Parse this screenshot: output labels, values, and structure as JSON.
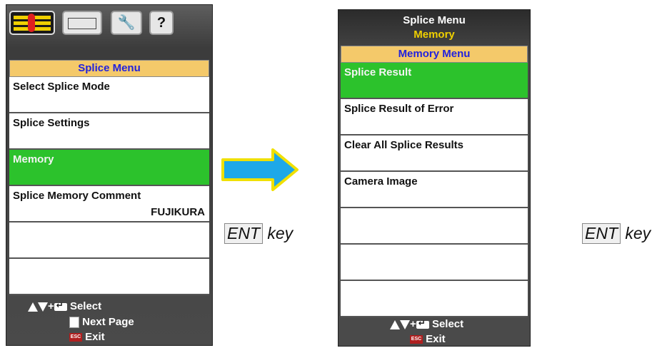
{
  "left": {
    "tabs": [
      {
        "name": "splice-tab-icon"
      },
      {
        "name": "splicer-tab-icon"
      },
      {
        "name": "maintenance-wrench-tab-icon"
      },
      {
        "name": "help-tab-icon",
        "glyph": "?"
      }
    ],
    "menu_title": "Splice Menu",
    "items": [
      {
        "label": "Select Splice Mode",
        "value": ""
      },
      {
        "label": "Splice Settings",
        "value": ""
      },
      {
        "label": "Memory",
        "value": "",
        "selected": true
      },
      {
        "label": "Splice Memory Comment",
        "value": "FUJIKURA"
      },
      {
        "label": "",
        "value": ""
      },
      {
        "label": "",
        "value": ""
      }
    ],
    "footer": {
      "select": "Select",
      "next_page": "Next Page",
      "exit": "Exit"
    }
  },
  "right": {
    "title": "Splice Menu",
    "subtitle": "Memory",
    "menu_title": "Memory Menu",
    "items": [
      {
        "label": "Splice Result",
        "selected": true
      },
      {
        "label": "Splice Result of Error"
      },
      {
        "label": "Clear All Splice Results"
      },
      {
        "label": "Camera Image"
      },
      {
        "label": ""
      },
      {
        "label": ""
      },
      {
        "label": ""
      }
    ],
    "footer": {
      "select": "Select",
      "exit": "Exit"
    }
  },
  "key_hint": {
    "key": "ENT",
    "suffix": "key"
  },
  "colors": {
    "selected": "#2cc22c",
    "menu_title_bg": "#f4c96a",
    "menu_title_text": "#2222dd",
    "subtitle": "#f0d000",
    "arrow_fill": "#1ea8e8",
    "arrow_outline": "#f0e000"
  }
}
